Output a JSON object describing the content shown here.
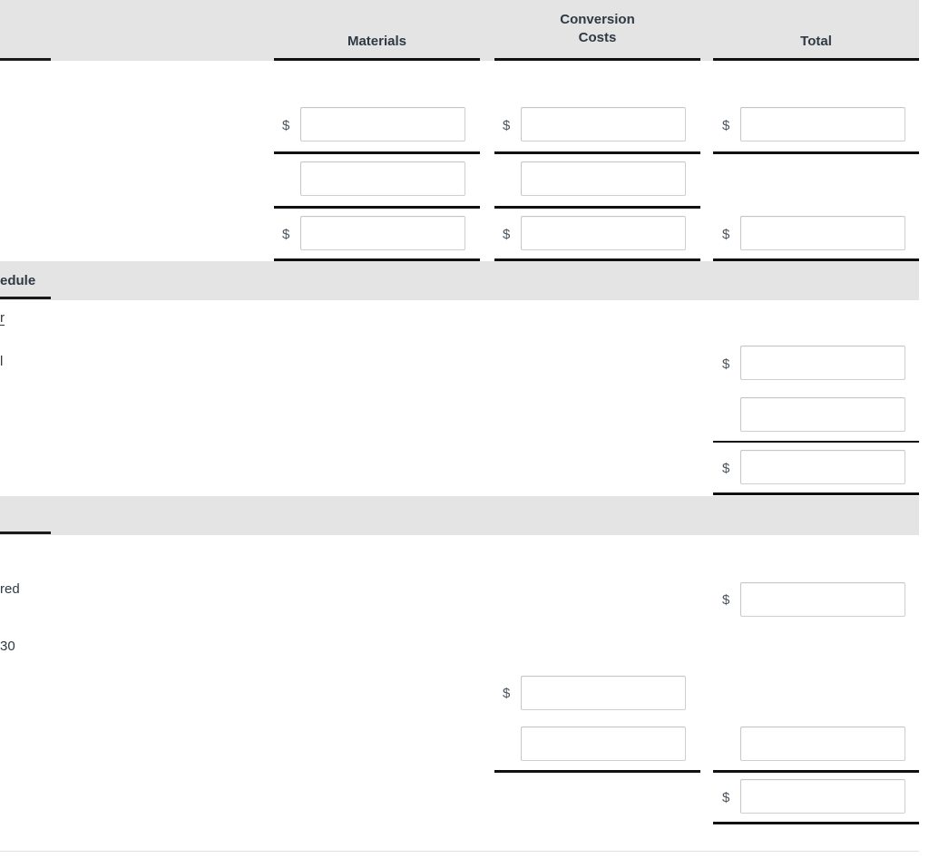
{
  "document": {
    "type": "production-cost-report-worksheet",
    "scroll_state": "scrolled-horizontally-row-labels-clipped"
  },
  "columns": {
    "materials": {
      "label": "Materials"
    },
    "conversion": {
      "label_line1": "Conversion",
      "label_line2": "Costs"
    },
    "total": {
      "label": "Total"
    }
  },
  "sections": {
    "costs_header_band": {
      "label": ""
    },
    "schedule_band": {
      "label": "edule"
    },
    "third_band": {
      "label": ""
    }
  },
  "row_labels": {
    "schedule_sub_a": "r",
    "schedule_row_1": "l",
    "schedule_row_2": "",
    "third_row_1": "red",
    "third_row_2": "30"
  },
  "currency_symbol": "$",
  "inputs": {
    "top_materials_1": {
      "value": "",
      "placeholder": ""
    },
    "top_materials_2": {
      "value": "",
      "placeholder": ""
    },
    "top_materials_3": {
      "value": "",
      "placeholder": ""
    },
    "top_conversion_1": {
      "value": "",
      "placeholder": ""
    },
    "top_conversion_2": {
      "value": "",
      "placeholder": ""
    },
    "top_conversion_3": {
      "value": "",
      "placeholder": ""
    },
    "top_total_1": {
      "value": "",
      "placeholder": ""
    },
    "top_total_3": {
      "value": "",
      "placeholder": ""
    },
    "mid_total_1": {
      "value": "",
      "placeholder": ""
    },
    "mid_total_2": {
      "value": "",
      "placeholder": ""
    },
    "mid_total_3": {
      "value": "",
      "placeholder": ""
    },
    "bot_total_1": {
      "value": "",
      "placeholder": ""
    },
    "bot_conversion_1": {
      "value": "",
      "placeholder": ""
    },
    "bot_conversion_2": {
      "value": "",
      "placeholder": ""
    },
    "bot_total_2": {
      "value": "",
      "placeholder": ""
    },
    "bot_total_3": {
      "value": "",
      "placeholder": ""
    }
  },
  "colors": {
    "band_background": "#e4e4e4",
    "rule": "#111111",
    "text": "#2f3943",
    "input_border": "#cfcfcf",
    "page_background": "#ffffff"
  }
}
